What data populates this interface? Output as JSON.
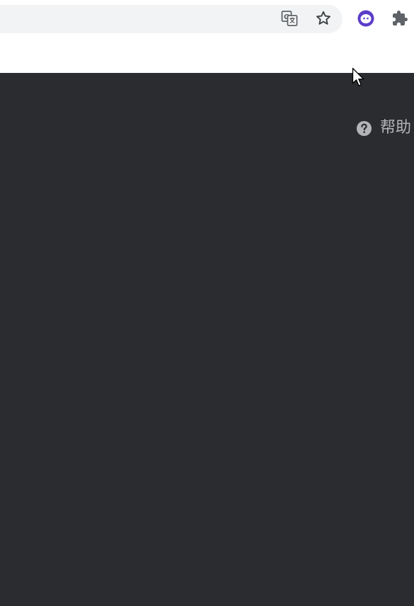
{
  "toolbar": {
    "translate_icon": "translate-icon",
    "bookmark_icon": "star-icon",
    "extensions": [
      {
        "name": "profile-extension-icon",
        "color": "#5c3dc9"
      },
      {
        "name": "puzzle-icon",
        "color": "#5f6368"
      }
    ]
  },
  "content": {
    "background": "#2b2c30",
    "help_label": "帮助",
    "help_icon": "question-circle-icon",
    "help_color": "#b2b4b8"
  }
}
